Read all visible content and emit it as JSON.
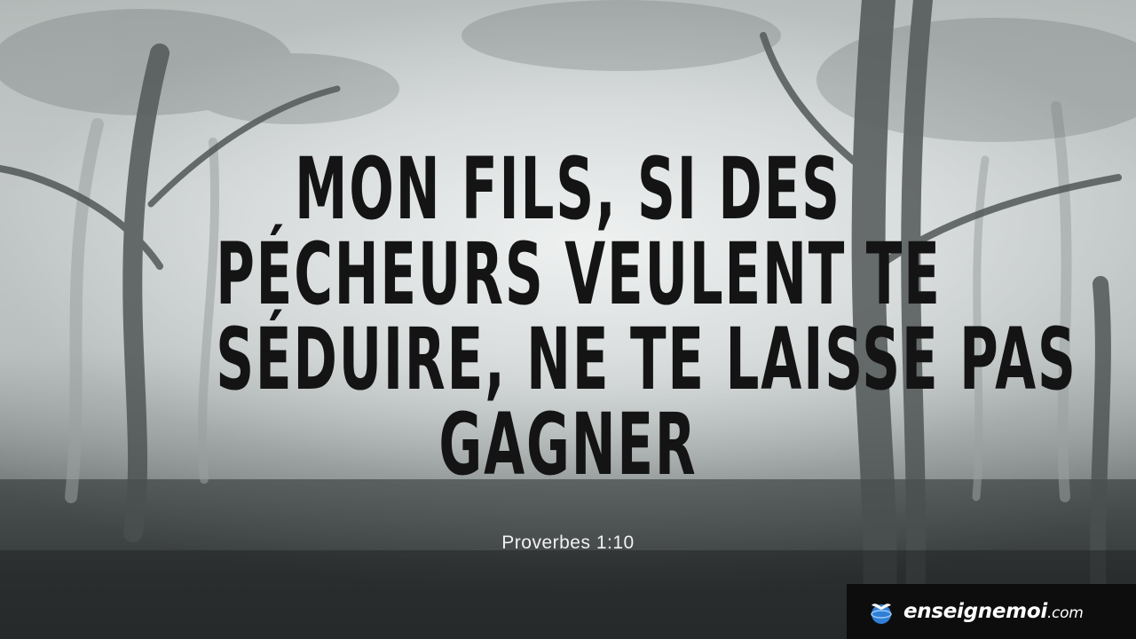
{
  "quote": {
    "lines": [
      "MON FILS, SI DES",
      "PÉCHEURS VEULENT TE",
      "SÉDUIRE, NE TE LAISSE PAS",
      "GAGNER"
    ]
  },
  "reference": "Proverbes 1:10",
  "brand": {
    "name": "enseignemoi",
    "tld": ".com",
    "icon": "globe-bird-icon",
    "accent_color": "#2f7fd6"
  },
  "colors": {
    "quote_text": "#141414",
    "reference_text": "#f2f2f2",
    "brand_background": "#0d0d0d"
  }
}
